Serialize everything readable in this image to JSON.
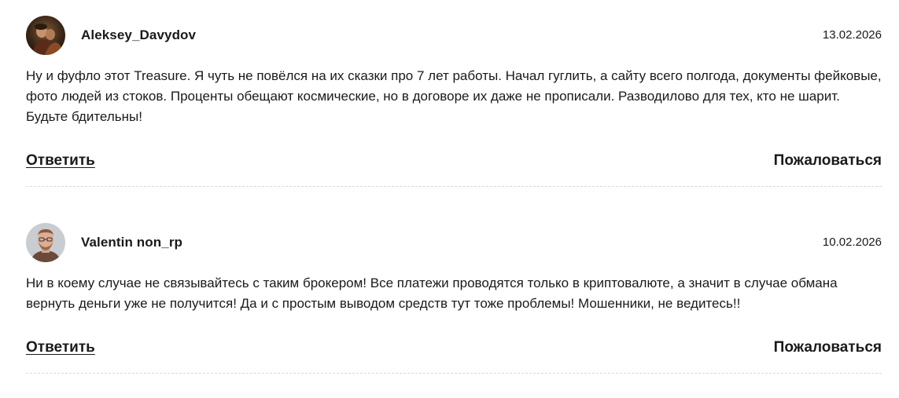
{
  "comments": [
    {
      "author": "Aleksey_Davydov",
      "date": "13.02.2026",
      "text": "Ну и фуфло этот Treasure. Я чуть не повёлся на их сказки про 7 лет работы. Начал гуглить, а сайту всего полгода, документы фейковые, фото людей из стоков. Проценты обещают космические, но в договоре их даже не прописали. Разводилово для тех, кто не шарит. Будьте бдительны!",
      "reply_label": "Ответить",
      "report_label": "Пожаловаться",
      "avatar_icon": "user-photo-painting"
    },
    {
      "author": "Valentin non_rp",
      "date": "10.02.2026",
      "text": "Ни в коему случае не связывайтесь с таким брокером! Все платежи проводятся только в криптовалюте, а значит в случае обмана вернуть деньги уже не получится! Да и с простым выводом средств тут тоже проблемы! Мошенники, не ведитесь!!",
      "reply_label": "Ответить",
      "report_label": "Пожаловаться",
      "avatar_icon": "user-photo-portrait"
    }
  ],
  "colors": {
    "text": "#1a1a1a",
    "divider": "#d9d9d9",
    "background": "#ffffff"
  }
}
